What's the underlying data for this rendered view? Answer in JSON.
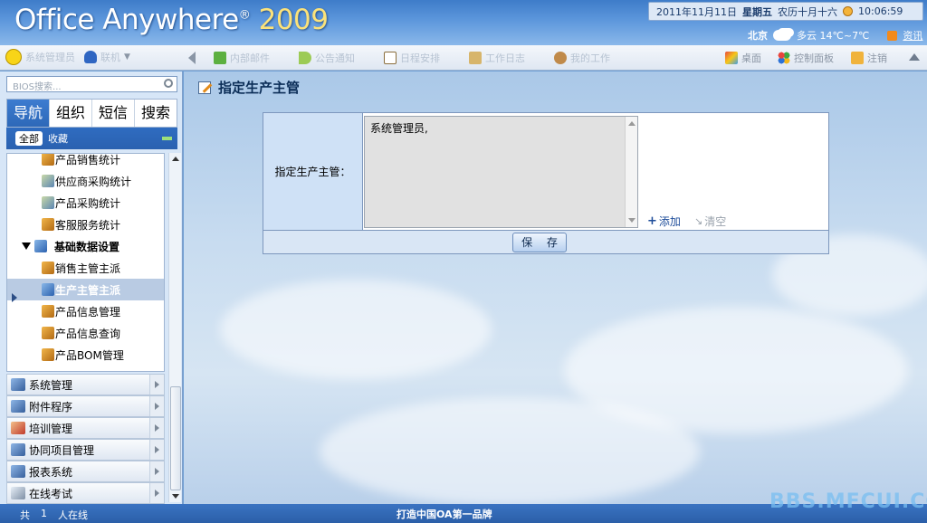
{
  "header": {
    "logo_text": "Office Anywhere",
    "logo_reg": "®",
    "logo_year": "2009",
    "date": "2011年11月11日",
    "weekday": "星期五",
    "lunar": "农历十月十六",
    "time": "10:06:59",
    "city": "北京",
    "weather": "多云 14℃~7℃",
    "news_label": "资讯"
  },
  "toolbar": {
    "user_label": "系统管理员",
    "status_label": "联机",
    "items": [
      {
        "label": "内部邮件",
        "icon": "mail-icon"
      },
      {
        "label": "公告通知",
        "icon": "speaker-icon"
      },
      {
        "label": "日程安排",
        "icon": "calendar-icon"
      },
      {
        "label": "工作日志",
        "icon": "notebook-icon"
      },
      {
        "label": "我的工作",
        "icon": "workflow-icon"
      }
    ],
    "right_items": [
      {
        "label": "桌面",
        "icon": "desktop-icon"
      },
      {
        "label": "控制面板",
        "icon": "control-panel-icon"
      },
      {
        "label": "注销",
        "icon": "key-icon"
      }
    ]
  },
  "sidebar": {
    "search_placeholder": "BIOS搜索...",
    "tabs": [
      "导航",
      "组织",
      "短信",
      "搜索"
    ],
    "filter_all": "全部",
    "filter_fav": "收藏",
    "tree": [
      {
        "label": "产品销售统计"
      },
      {
        "label": "供应商采购统计"
      },
      {
        "label": "产品采购统计"
      },
      {
        "label": "客服服务统计"
      },
      {
        "label": "基础数据设置"
      },
      {
        "label": "销售主管主派"
      },
      {
        "label": "生产主管主派"
      },
      {
        "label": "产品信息管理"
      },
      {
        "label": "产品信息查询"
      },
      {
        "label": "产品BOM管理"
      }
    ],
    "menus": [
      "系统管理",
      "附件程序",
      "培训管理",
      "协同项目管理",
      "报表系统",
      "在线考试"
    ]
  },
  "main": {
    "title": "指定生产主管",
    "field_label": "指定生产主管：",
    "field_value": "系统管理员,",
    "add_label": "添加",
    "clear_label": "清空",
    "save_label": "保 存"
  },
  "statusbar": {
    "total_label": "共",
    "online_count": "1",
    "online_suffix": "人在线",
    "slogan": "打造中国OA第一品牌"
  },
  "watermark": "BBS.MFCUI.COM",
  "colors": {
    "accent": "#2d68b8",
    "header_blue": "#3e7cc9",
    "selected_row": "#b9cbe3"
  }
}
